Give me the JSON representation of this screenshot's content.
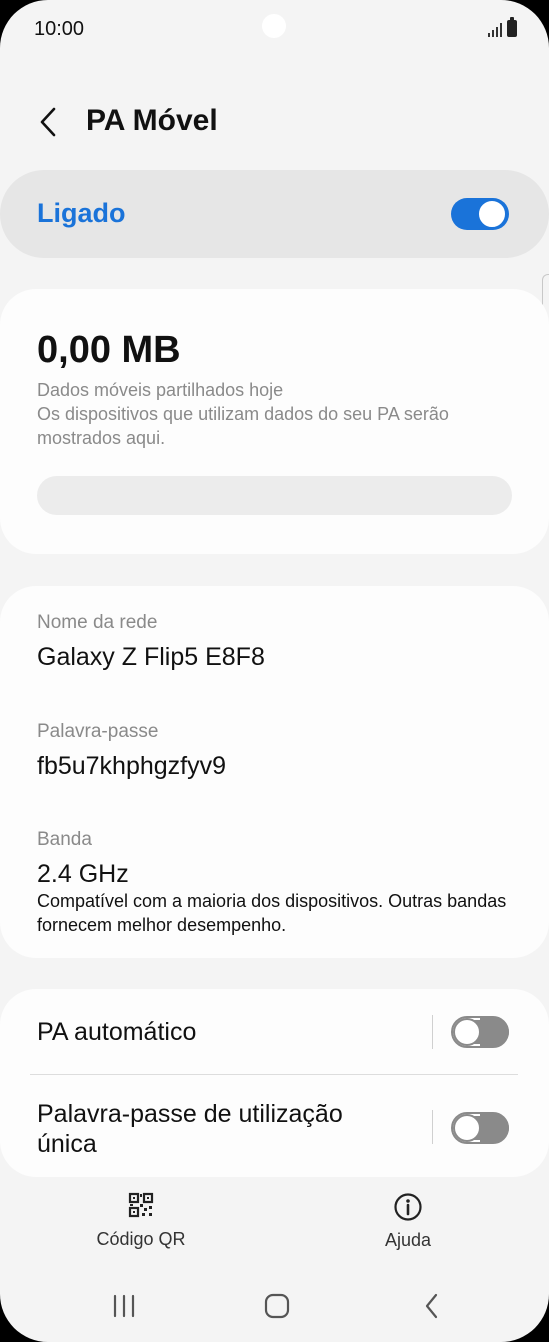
{
  "status_bar": {
    "time": "10:00"
  },
  "header": {
    "title": "PA Móvel"
  },
  "master_switch": {
    "label": "Ligado",
    "state": "on",
    "accent": "#1a73d9"
  },
  "usage": {
    "value": "0,00 MB",
    "line1": "Dados móveis partilhados hoje",
    "line2": "Os dispositivos que utilizam dados do seu PA serão mostrados aqui."
  },
  "network": {
    "name_label": "Nome da rede",
    "name_value": "Galaxy Z Flip5 E8F8",
    "password_label": "Palavra-passe",
    "password_value": "fb5u7khphgzfyv9",
    "band_label": "Banda",
    "band_value": "2.4 GHz",
    "band_desc": "Compatível com a maioria dos dispositivos. Outras bandas fornecem melhor desempenho."
  },
  "options": [
    {
      "label": "PA automático",
      "state": "off"
    },
    {
      "label": "Palavra-passe de utilização única",
      "state": "off"
    }
  ],
  "bottom_actions": {
    "qr_label": "Código QR",
    "help_label": "Ajuda"
  },
  "icons": {
    "back": "chevron-left-icon",
    "qr": "qr-code-icon",
    "help": "info-icon",
    "nav_recents": "recents-icon",
    "nav_home": "home-icon",
    "nav_back": "back-icon"
  }
}
